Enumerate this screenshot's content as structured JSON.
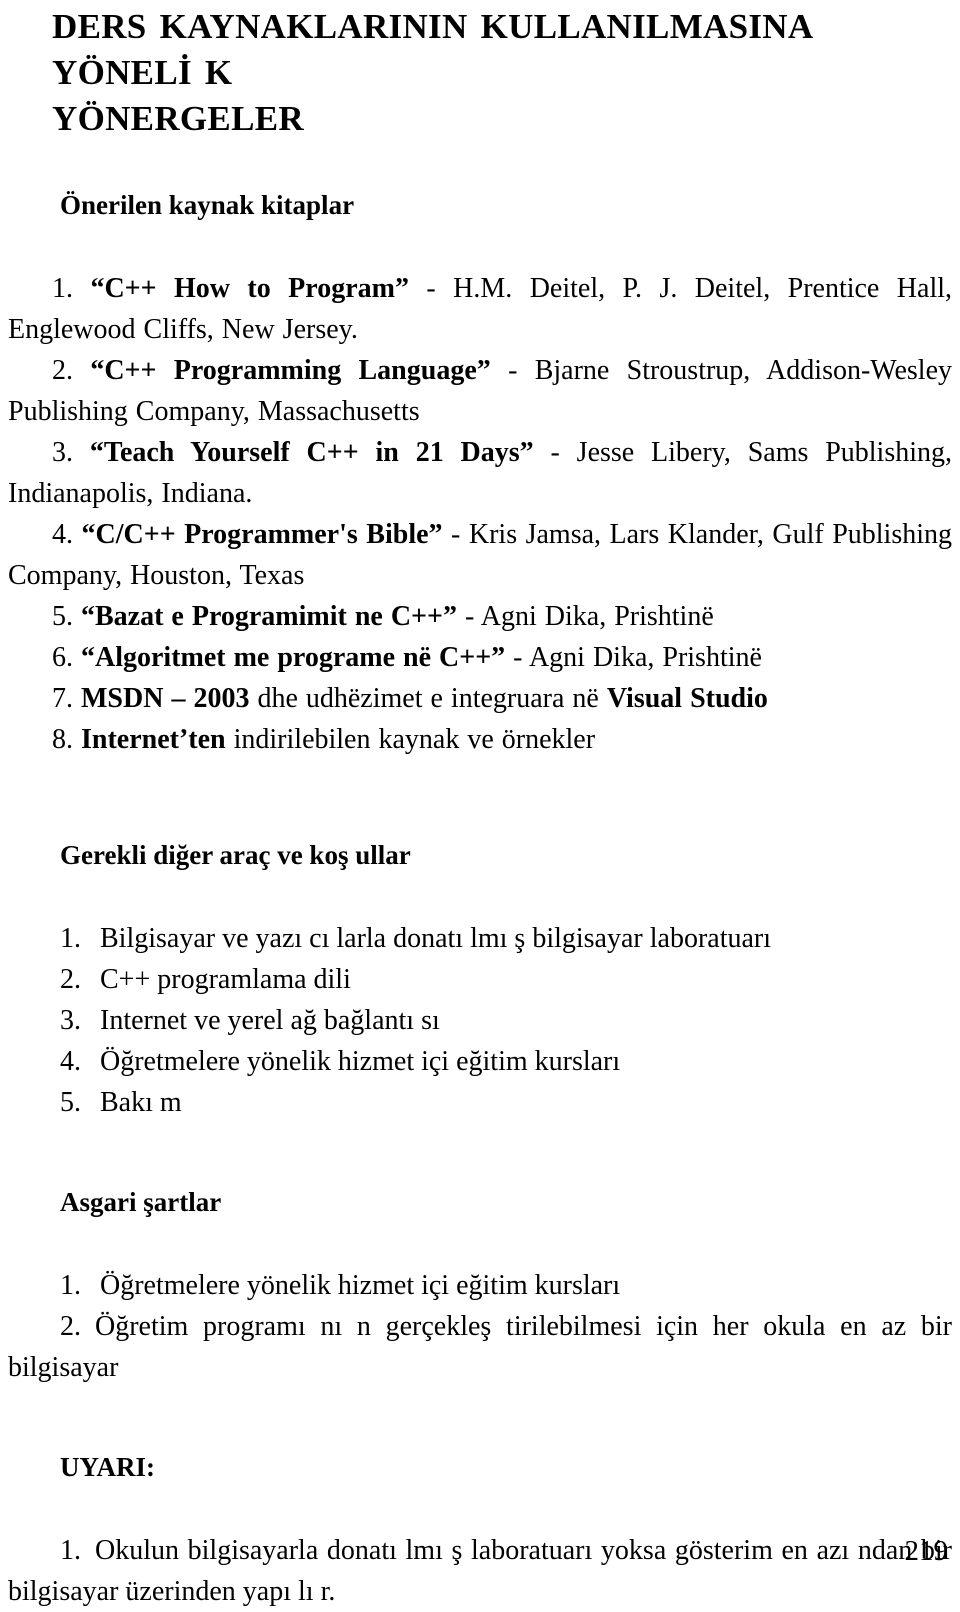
{
  "document": {
    "title_line_1": "DERS KAYNAKLARININ KULLANILMASINA YÖNELİ K",
    "title_line_2": "YÖNERGELER",
    "page_number": "219"
  },
  "sections": {
    "books": {
      "heading": "Önerilen kaynak kitaplar",
      "items": [
        {
          "number": "1.",
          "quoted_title": "“C++ How to Program”",
          "rest": " - H.M. Deitel, P. J. Deitel, Prentice Hall, Englewood Cliffs, New Jersey."
        },
        {
          "number": "2.",
          "quoted_title": "“C++ Programming Language”",
          "rest": " - Bjarne Stroustrup, Addison-Wesley Publishing Company, Massachusetts"
        },
        {
          "number": "3.",
          "quoted_title": "“Teach Yourself C++ in 21 Days”",
          "rest": " -  Jesse Libery, Sams Publishing, Indianapolis, Indiana."
        },
        {
          "number": "4.",
          "quoted_title": "“C/C++ Programmer's Bible”",
          "rest": " - Kris Jamsa, Lars Klander, Gulf Publishing Company, Houston, Texas"
        },
        {
          "number": "5.",
          "quoted_title": "“Bazat e Programimit ne C++”",
          "rest": " - Agni Dika, Prishtinë"
        },
        {
          "number": "6.",
          "quoted_title": "“Algoritmet me programe në C++”",
          "rest": " - Agni Dika, Prishtinë"
        },
        {
          "number": "7.",
          "quoted_title": "MSDN – 2003",
          "rest": " dhe udhëzimet e integruara në ",
          "trailing_bold": "Visual Studio"
        },
        {
          "number": "8.",
          "quoted_title": "Internet’ten",
          "rest": " indirilebilen kaynak ve örnekler"
        }
      ]
    },
    "tools": {
      "heading": "Gerekli diğer araç ve koş ullar",
      "items": [
        {
          "number": "1.",
          "text": "Bilgisayar ve yazı cı larla donatı lmı ş bilgisayar laboratuarı"
        },
        {
          "number": "2.",
          "text": "C++ programlama dili"
        },
        {
          "number": "3.",
          "text": "Internet ve yerel ağ bağlantı sı"
        },
        {
          "number": "4.",
          "text": "Öğretmelere yönelik hizmet içi eğitim kursları"
        },
        {
          "number": "5.",
          "text": "Bakı m"
        }
      ]
    },
    "minimum": {
      "heading": "Asgari şartlar",
      "items": [
        {
          "number": "1.",
          "text": "Öğretmelere yönelik hizmet içi eğitim kursları"
        },
        {
          "number": "2.",
          "text": "Öğretim programı nı n gerçekleş tirilebilmesi için her okula en az bir bilgisayar"
        }
      ]
    },
    "warning": {
      "heading": "UYARI:",
      "items": [
        {
          "number": "1.",
          "text": "Okulun bilgisayarla donatı lmı ş laboratuarı  yoksa gösterim en azı ndan bir bilgisayar üzerinden yapı lı r."
        }
      ]
    }
  }
}
